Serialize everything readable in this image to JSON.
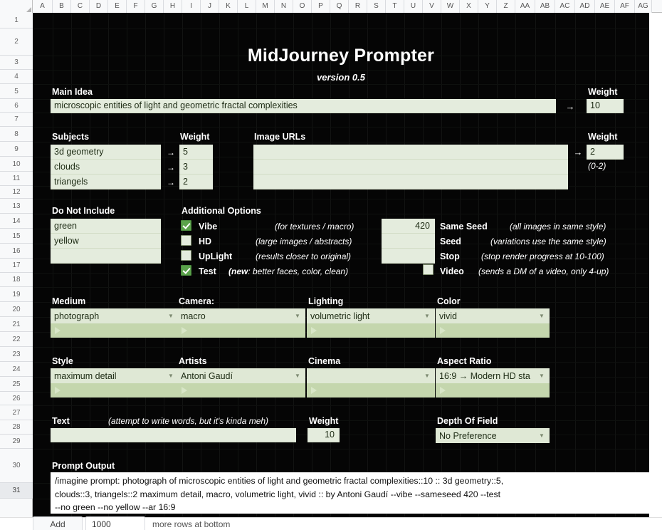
{
  "spreadsheet": {
    "columns": [
      "A",
      "B",
      "C",
      "D",
      "E",
      "F",
      "G",
      "H",
      "I",
      "J",
      "K",
      "L",
      "M",
      "N",
      "O",
      "P",
      "Q",
      "R",
      "S",
      "T",
      "U",
      "V",
      "W",
      "X",
      "Y",
      "Z",
      "AA",
      "AB",
      "AC",
      "AD",
      "AE",
      "AF",
      "AG"
    ],
    "rows": [
      "1",
      "2",
      "3",
      "4",
      "5",
      "6",
      "7",
      "8",
      "9",
      "10",
      "11",
      "12",
      "13",
      "14",
      "15",
      "16",
      "17",
      "18",
      "19",
      "20",
      "21",
      "22",
      "23",
      "24",
      "25",
      "26",
      "27",
      "28",
      "29",
      "30",
      "31"
    ],
    "selected_row": "31"
  },
  "header": {
    "title": "MidJourney Prompter",
    "subtitle": "version 0.5"
  },
  "main_idea": {
    "label": "Main Idea",
    "value": "microscopic entities of light and geometric fractal complexities",
    "arrow": "→",
    "weight_label": "Weight",
    "weight_value": "10"
  },
  "subjects": {
    "label": "Subjects",
    "weight_label": "Weight",
    "arrow": "→",
    "rows": [
      {
        "subject": "3d geometry",
        "weight": "5"
      },
      {
        "subject": "clouds",
        "weight": "3"
      },
      {
        "subject": "triangels",
        "weight": "2"
      }
    ]
  },
  "image_urls": {
    "label": "Image URLs",
    "arrow": "→",
    "values": [
      "",
      "",
      ""
    ],
    "weight_label": "Weight",
    "weight_value": "2",
    "weight_range_hint": "(0-2)"
  },
  "do_not_include": {
    "label": "Do Not Include",
    "values": [
      "green",
      "yellow",
      ""
    ]
  },
  "additional_options": {
    "label": "Additional Options",
    "items": [
      {
        "name": "Vibe",
        "checked": true,
        "hint": "(for textures / macro)",
        "hint_bold_prefix": ""
      },
      {
        "name": "HD",
        "checked": false,
        "hint": "(large images / abstracts)",
        "hint_bold_prefix": ""
      },
      {
        "name": "UpLight",
        "checked": false,
        "hint": "(results closer to original)",
        "hint_bold_prefix": ""
      },
      {
        "name": "Test",
        "checked": true,
        "hint": ": better faces, color, clean)",
        "hint_bold_prefix": "(new"
      }
    ]
  },
  "seed_options": {
    "items": [
      {
        "name": "Same Seed",
        "value": "420",
        "hint": "(all images in same style)"
      },
      {
        "name": "Seed",
        "value": "",
        "hint": "(variations use the same style)"
      },
      {
        "name": "Stop",
        "value": "",
        "hint": "(stop render progress at 10-100)"
      }
    ],
    "video": {
      "name": "Video",
      "checked": false,
      "hint": "(sends a DM of a video, only 4-up)"
    }
  },
  "selectors_row1": [
    {
      "label": "Medium",
      "value": "photograph"
    },
    {
      "label": "Camera:",
      "value": "macro"
    },
    {
      "label": "Lighting",
      "value": "volumetric light"
    },
    {
      "label": "Color",
      "value": "vivid"
    }
  ],
  "selectors_row2": [
    {
      "label": "Style",
      "value": "maximum detail"
    },
    {
      "label": "Artists",
      "value": "Antoni Gaudí"
    },
    {
      "label": "Cinema",
      "value": ""
    },
    {
      "label": "Aspect Ratio",
      "value": "16:9 → Modern HD sta"
    }
  ],
  "text_row": {
    "label": "Text",
    "hint": "(attempt to write words, but it's kinda meh)",
    "value": "",
    "weight_label": "Weight",
    "weight_value": "10",
    "dof_label": "Depth Of Field",
    "dof_value": "No Preference"
  },
  "prompt_output": {
    "label": "Prompt Output",
    "lines": [
      "/imagine prompt: photograph of microscopic entities of light and geometric fractal complexities::10 :: 3d geometry::5,",
      "clouds::3, triangels::2 maximum detail, macro, volumetric light, vivid :: by Antoni Gaudí --vibe --sameseed 420 --test",
      "--no green --no yellow --ar 16:9"
    ]
  },
  "bottom_bar": {
    "add_label": "Add",
    "rows_value": "1000",
    "note": "more rows at bottom"
  },
  "colors": {
    "sheet_bg": "#050505",
    "field_bg": "#e4ecdd",
    "dropdown_bg": "#dfe8d5",
    "dropdown_bar_bg": "#c4d6ad",
    "checkbox_on": "#5aa24a",
    "output_bg": "#ffffff"
  }
}
